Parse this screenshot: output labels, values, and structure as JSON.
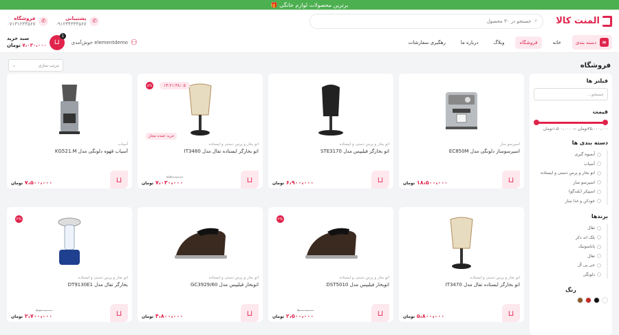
{
  "banner": {
    "text": "برترین محصولات لوازم خانگی 🎁"
  },
  "header": {
    "logo_text": "المنت کالا",
    "search_placeholder": "جستجو در ۳۰ محصول",
    "support": {
      "label": "پشتیبانی",
      "phone": "۰۹۱۲۳۴۳۳۴۵۶۷"
    },
    "store": {
      "label": "فروشگاه",
      "phone": "۰۷۱۳۱۲۳۴۵۶۷"
    }
  },
  "nav": {
    "category_button": "دسته بندی",
    "links": [
      "خانه",
      "فروشگاه",
      "وبلاگ",
      "درباره ما",
      "رهگیری سفارشات"
    ],
    "active_index": 1,
    "user": "elementdemo خوش‌آمدی",
    "cart": {
      "title": "سبد خرید",
      "price": "۷،۰۳۰،۰۰۰",
      "currency": "تومان",
      "count": "1"
    }
  },
  "page": {
    "title": "فروشگاه",
    "sort_label": "مرتب سازی"
  },
  "sidebar": {
    "filters_title": "فیلتر ها",
    "search_placeholder": "جستجو...",
    "price_title": "قیمت",
    "price_range": "۳۵،۰۰۰،۰۰۰تومان — ۱،۵۰۰،۰۰۰تومان",
    "categories_title": "دسته بندی ها",
    "categories": [
      "آبمیوه گیری",
      "آسیاب",
      "اتو بخار و پرس دستی و ایستاده",
      "اسپرسو ساز",
      "اسپیکر (بلندگو)",
      "خودکن و غذا ساز"
    ],
    "brands_title": "برندها",
    "brands": [
      "تفال",
      "بلک اند دکر",
      "پاناسونیک",
      "تفال",
      "جی پی آل",
      "دلونگی"
    ],
    "color_title": "رنگ",
    "colors": [
      "#ffffff",
      "#111111",
      "#c62828",
      "#8d5a2b"
    ]
  },
  "products": [
    {
      "name": "اسپرسوساز دلونگی مدل EC850M",
      "category": "اسپرسو ساز",
      "price": "۱۸،۵۰۰،۰۰۰",
      "old": "",
      "image": "espresso-machine"
    },
    {
      "name": "اتو بخارگر فیلیپس مدل STE3170",
      "category": "اتو بخار و پرس دستی و ایستاده",
      "price": "۶،۹۰۰،۰۰۰",
      "old": "",
      "image": "garment-steamer"
    },
    {
      "name": "اتو بخارگر ایستاده تفال مدل IT3480",
      "category": "اتو بخار و پرس دستی و ایستاده",
      "price": "۷،۰۳۰،۰۰۰",
      "old": "۷،۴۰۰،۰۰۰",
      "image": "standing-steamer",
      "badge": "۵%",
      "timer": "۱۴:۲۱:۳۸:۰۵",
      "tag": "خرید عمده مجاز"
    },
    {
      "name": "آسیاب قهوه دلونگی مدل KG521.M",
      "category": "آسیاب",
      "price": "۷،۵۰۰،۰۰۰",
      "old": "",
      "image": "coffee-grinder"
    },
    {
      "name": "اتو بخارگر ایستاده تفال مدل IT3470",
      "category": "اتو بخار و پرس دستی و ایستاده",
      "price": "۵،۸۰۰،۰۰۰",
      "old": "",
      "image": "standing-steamer"
    },
    {
      "name": "اتوبخار فیلیپس مدل DST5010",
      "category": "اتو بخار و پرس دستی و ایستاده",
      "price": "۲،۵۰۰،۰۰۰",
      "old": "۳،۰۰۰،۰۰۰",
      "image": "steam-iron",
      "badge": "۲%"
    },
    {
      "name": "اتوبخار فیلیپس مدل GC3929/60",
      "category": "اتو بخار و پرس دستی و ایستاده",
      "price": "۴،۸۰۰،۰۰۰",
      "old": "",
      "image": "steam-iron"
    },
    {
      "name": "بخارگر تفال مدل DT9130E1",
      "category": "اتو بخار و پرس دستی و ایستاده",
      "price": "۲،۷۰۰،۰۰۰",
      "old": "۲،۸۰۰،۰۰۰",
      "image": "handheld-steamer",
      "badge": "۴%"
    }
  ],
  "currency": "تومان"
}
